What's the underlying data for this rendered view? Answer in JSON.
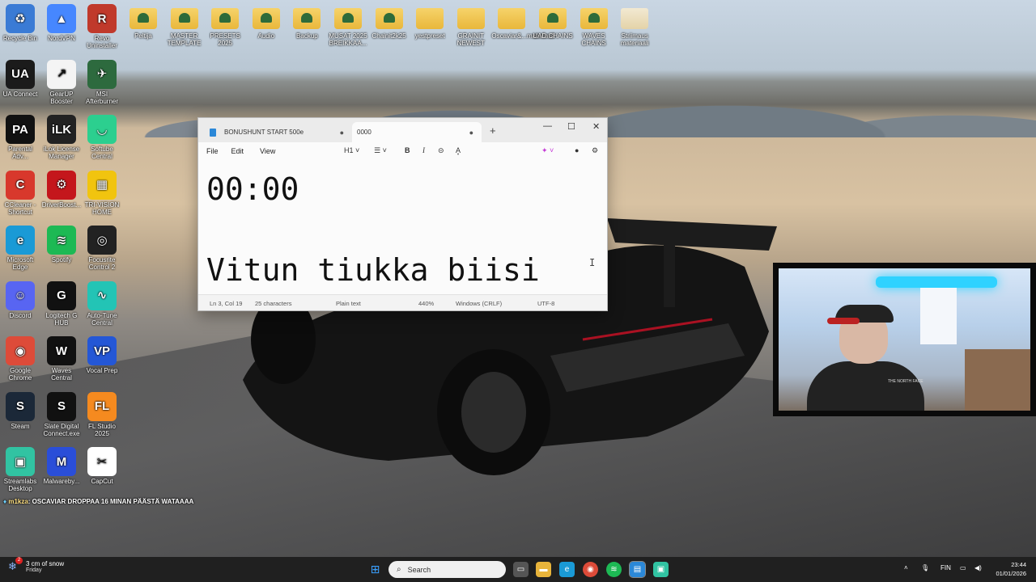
{
  "desktop": {
    "icons_col1": [
      {
        "label": "Recycle Bin",
        "icon": "recycle-bin-icon",
        "glyph": "♻",
        "color": "#3a7bd5"
      },
      {
        "label": "UA Connect",
        "icon": "ua-connect-icon",
        "glyph": "UA",
        "color": "#1b1b1b"
      },
      {
        "label": "Parental Adv...",
        "icon": "parental-advisory-icon",
        "glyph": "PA",
        "color": "#111111"
      },
      {
        "label": "CCleaner - Shortcut",
        "icon": "ccleaner-icon",
        "glyph": "C",
        "color": "#d8382c"
      },
      {
        "label": "Microsoft Edge",
        "icon": "edge-icon",
        "glyph": "e",
        "color": "#1a9ad6"
      },
      {
        "label": "Discord",
        "icon": "discord-icon",
        "glyph": "☺",
        "color": "#5865f2"
      },
      {
        "label": "Google Chrome",
        "icon": "chrome-icon",
        "glyph": "◉",
        "color": "#dd4b39"
      },
      {
        "label": "Steam",
        "icon": "steam-icon",
        "glyph": "S",
        "color": "#1b2838"
      },
      {
        "label": "Streamlabs Desktop",
        "icon": "streamlabs-icon",
        "glyph": "▣",
        "color": "#31c3a2"
      }
    ],
    "icons_col2": [
      {
        "label": "NordVPN",
        "icon": "nordvpn-icon",
        "glyph": "▲",
        "color": "#4687ff"
      },
      {
        "label": "GearUP Booster",
        "icon": "gearup-icon",
        "glyph": "↗",
        "color": "#f4f4f4"
      },
      {
        "label": "iLok License Manager",
        "icon": "ilok-icon",
        "glyph": "iLK",
        "color": "#222222"
      },
      {
        "label": "DriverBoost...",
        "icon": "driverbooster-icon",
        "glyph": "⚙",
        "color": "#c4161c"
      },
      {
        "label": "Spotify",
        "icon": "spotify-icon",
        "glyph": "≋",
        "color": "#1db954"
      },
      {
        "label": "Logitech G HUB",
        "icon": "logitech-icon",
        "glyph": "G",
        "color": "#111111"
      },
      {
        "label": "Waves Central",
        "icon": "waves-icon",
        "glyph": "W",
        "color": "#111111"
      },
      {
        "label": "Slate Digital Connect.exe",
        "icon": "slate-digital-icon",
        "glyph": "S",
        "color": "#111111"
      },
      {
        "label": "Malwareby...",
        "icon": "malwarebytes-icon",
        "glyph": "M",
        "color": "#2a4ed8"
      }
    ],
    "icons_col3": [
      {
        "label": "Revo Uninstaller",
        "icon": "revo-uninstaller-icon",
        "glyph": "R",
        "color": "#c0392b"
      },
      {
        "label": "MSI Afterburner",
        "icon": "msi-afterburner-icon",
        "glyph": "✈",
        "color": "#2d6a3e"
      },
      {
        "label": "Softube Central",
        "icon": "softube-icon",
        "glyph": "◡",
        "color": "#2ccf8f"
      },
      {
        "label": "TRI-VISION HOME",
        "icon": "trivision-icon",
        "glyph": "▦",
        "color": "#f1c40f"
      },
      {
        "label": "Focusrite Control 2",
        "icon": "focusrite-icon",
        "glyph": "◎",
        "color": "#222222"
      },
      {
        "label": "Auto-Tune Central",
        "icon": "autotune-icon",
        "glyph": "∿",
        "color": "#23c4b5"
      },
      {
        "label": "Vocal Prep",
        "icon": "vocal-prep-icon",
        "glyph": "VP",
        "color": "#2457d6"
      },
      {
        "label": "FL Studio 2025",
        "icon": "fl-studio-icon",
        "glyph": "FL",
        "color": "#f58a1f"
      },
      {
        "label": "CapCut",
        "icon": "capcut-icon",
        "glyph": "✂",
        "color": "#ffffff"
      }
    ],
    "folders": [
      {
        "label": "Peltija",
        "type": "green"
      },
      {
        "label": "MASTER TEMPLATE",
        "type": "green"
      },
      {
        "label": "PRESETS 2025",
        "type": "green"
      },
      {
        "label": "Audio",
        "type": "green"
      },
      {
        "label": "Backup",
        "type": "green"
      },
      {
        "label": "MUSAT 2025 BREIKKAA...",
        "type": "green"
      },
      {
        "label": "Chainit2k25",
        "type": "green"
      },
      {
        "label": "yestpreset",
        "type": "plain"
      },
      {
        "label": "GRAINIT NEWEST",
        "type": "plain"
      },
      {
        "label": "Oscaviar&...materiaali",
        "type": "pink"
      },
      {
        "label": "UAD CHAINS",
        "type": "green"
      },
      {
        "label": "WAVES CHAINS",
        "type": "green"
      },
      {
        "label": "Striimaus materiaali",
        "type": "white"
      }
    ]
  },
  "notepad": {
    "tabs": [
      {
        "label": "BONUSHUNT START 500e",
        "unsaved": "●"
      },
      {
        "label": "0000",
        "unsaved": "●"
      }
    ],
    "new_tab": "+",
    "controls": {
      "minimize": "—",
      "maximize": "☐",
      "close": "✕"
    },
    "menu": [
      "File",
      "Edit",
      "View"
    ],
    "toolbar": {
      "heading": "H1",
      "list": "☰",
      "bold": "B",
      "italic": "I",
      "link": "⊝",
      "clear": "A͓"
    },
    "content_line1": "00:00",
    "content_line2": "Vitun tiukka biisi",
    "status": {
      "position": "Ln 3, Col 19",
      "characters": "25 characters",
      "format": "Plain text",
      "zoom": "440%",
      "line_ending": "Windows (CRLF)",
      "encoding": "UTF-8"
    }
  },
  "webcam": {
    "shirt_logo": "THE NORTH FACE"
  },
  "chat": {
    "user": "m1kza",
    "message": ": OSCAVIAR DROPPAA 16 MINAN PÄÄSTÄ WATAAAA"
  },
  "taskbar": {
    "weather_badge": "2",
    "weather_temp": "3 cm of snow",
    "weather_day": "Friday",
    "search_placeholder": "Search",
    "language": "FIN",
    "time": "23:44",
    "date": "01/01/2026"
  }
}
